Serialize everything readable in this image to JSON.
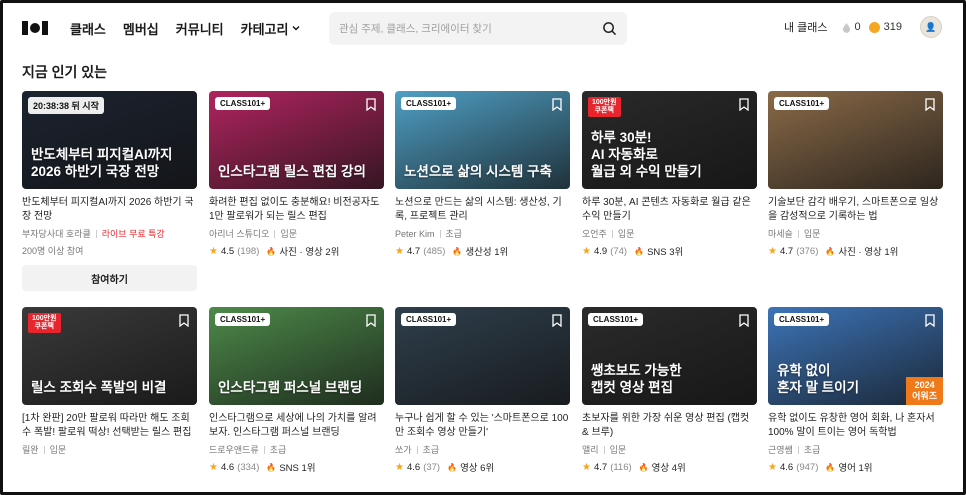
{
  "header": {
    "nav": [
      "클래스",
      "멤버십",
      "커뮤니티",
      "카테고리"
    ],
    "search_placeholder": "관심 주제, 클래스, 크리에이터 찾기",
    "my_class": "내 클래스",
    "points": "0",
    "coins": "319"
  },
  "section_title": "지금 인기 있는",
  "cards": [
    {
      "thumb_text": "반도체부터 피지컬AI까지\n2026 하반기 국장 전망",
      "timer": "20:38:38 뒤 시작",
      "title": "반도체부터 피지컬AI까지 2026 하반기 국장 전망",
      "creator": "부자당사대 호라클",
      "tag": "라이브 무료 특강",
      "joined": "200명 이상 참여",
      "join_label": "참여하기",
      "bg": "#1c2330"
    },
    {
      "badge": "CLASS101+",
      "thumb_text": "인스타그램 릴스 편집 강의",
      "title": "화려한 편집 없이도 충분해요! 비전공자도 1만 팔로워가 되는 릴스 편집",
      "creator": "아리너 스튜디오",
      "level": "입문",
      "rating": "4.5",
      "count": "(198)",
      "rank": "사진 · 영상 2위",
      "bg": "#b0245e"
    },
    {
      "badge": "CLASS101+",
      "thumb_text": "노션으로 삶의 시스템 구축",
      "title": "노션으로 만드는 삶의 시스템: 생산성, 기록, 프로젝트 관리",
      "creator": "Peter Kim",
      "level": "초급",
      "rating": "4.7",
      "count": "(485)",
      "rank": "생산성 1위",
      "bg": "#4f9fc4"
    },
    {
      "badge_red": "100만원\n쿠폰팩",
      "thumb_text": "하루 30분!\nAI 자동화로\n월급 외 수익 만들기",
      "title": "하루 30분, AI 콘텐츠 자동화로 월급 같은 수익 만들기",
      "creator": "오언주",
      "level": "입문",
      "rating": "4.9",
      "count": "(74)",
      "rank": "SNS 3위",
      "bg": "#2a2a2a"
    },
    {
      "badge": "CLASS101+",
      "thumb_text": "",
      "title": "기술보단 감각 배우기, 스마트폰으로 일상을 감성적으로 기록하는 법",
      "creator": "마세슬",
      "level": "입문",
      "rating": "4.7",
      "count": "(376)",
      "rank": "사진 · 영상 1위",
      "bg": "#8a6a48"
    },
    {
      "badge_red": "100만원\n쿠폰팩",
      "thumb_text": "릴스 조회수 폭발의 비결",
      "title": "[1차 완판] 20만 팔로워 따라만 해도 조회수 폭발! 팔로워 떡상! 선택받는 릴스 편집",
      "creator": "릴완",
      "level": "입문",
      "rating": "",
      "count": "",
      "rank": "",
      "bg": "#3a3a3a"
    },
    {
      "badge": "CLASS101+",
      "thumb_text": "인스타그램 퍼스널 브랜딩",
      "title": "인스타그램으로 세상에 나의 가치를 알려보자. 인스타그램 퍼스널 브랜딩",
      "creator": "드로우앤드류",
      "level": "초급",
      "rating": "4.6",
      "count": "(334)",
      "rank": "SNS 1위",
      "bg": "#4d8a4a"
    },
    {
      "badge": "CLASS101+",
      "thumb_text": "",
      "title": "누구나 쉽게 할 수 있는 '스마트폰으로 100만 조회수 영상 만들기'",
      "creator": "쏘가",
      "level": "초급",
      "rating": "4.6",
      "count": "(37)",
      "rank": "영상 6위",
      "bg": "#2f3f4c"
    },
    {
      "badge": "CLASS101+",
      "thumb_text": "쌩초보도 가능한\n캡컷 영상 편집",
      "title": "초보자를 위한 가장 쉬운 영상 편집 (캡컷 & 브루)",
      "creator": "앨리",
      "level": "입문",
      "rating": "4.7",
      "count": "(116)",
      "rank": "영상 4위",
      "bg": "#2b2b2b"
    },
    {
      "badge": "CLASS101+",
      "thumb_text": "유학 없이\n혼자 말 트이기",
      "corner_tag": "2024\n어워즈",
      "title": "유학 없이도 유창한 영어 회화, 나 혼자서 100% 말이 트이는 영어 독학법",
      "creator": "근영쌤",
      "level": "초급",
      "rating": "4.6",
      "count": "(947)",
      "rank": "영어 1위",
      "bg": "#3d74b8"
    }
  ]
}
